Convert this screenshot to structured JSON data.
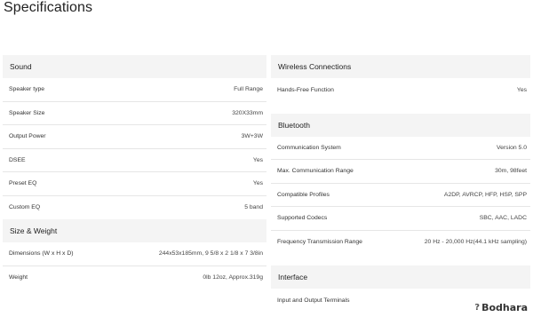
{
  "page_title": "Specifications",
  "left_sections": [
    {
      "title": "Sound",
      "rows": [
        {
          "label": "Speaker type",
          "value": "Full Range"
        },
        {
          "label": "Speaker Size",
          "value": "320X33mm"
        },
        {
          "label": "Output Power",
          "value": "3W+3W"
        },
        {
          "label": "DSEE",
          "value": "Yes"
        },
        {
          "label": "Preset EQ",
          "value": "Yes"
        },
        {
          "label": "Custom EQ",
          "value": "5 band"
        }
      ]
    },
    {
      "title": "Size & Weight",
      "rows": [
        {
          "label": "Dimensions (W x H x D)",
          "value": "244x53x185mm, 9 5/8 x 2 1/8 x 7 3/8in"
        },
        {
          "label": "Weight",
          "value": "0lb 12oz, Approx.319g"
        }
      ]
    }
  ],
  "right_sections": [
    {
      "title": "Wireless Connections",
      "rows": [
        {
          "label": "Hands-Free Function",
          "value": "Yes"
        }
      ]
    },
    {
      "title": "Bluetooth",
      "rows": [
        {
          "label": "Communication System",
          "value": "Version 5.0"
        },
        {
          "label": "Max. Communication Range",
          "value": "30m, 98feet"
        },
        {
          "label": "Compatible Profiles",
          "value": "A2DP, AVRCP, HFP, HSP, SPP"
        },
        {
          "label": "Supported Codecs",
          "value": "SBC, AAC, LADC"
        },
        {
          "label": "Frequency Transmission Range",
          "value": "20 Hz - 20,000 Hz(44.1 kHz sampling)"
        }
      ]
    },
    {
      "title": "Interface",
      "rows": [
        {
          "label": "Input and Output Terminals",
          "value": ""
        }
      ]
    }
  ],
  "watermark": {
    "text": "Bodhara",
    "sign": "?"
  }
}
